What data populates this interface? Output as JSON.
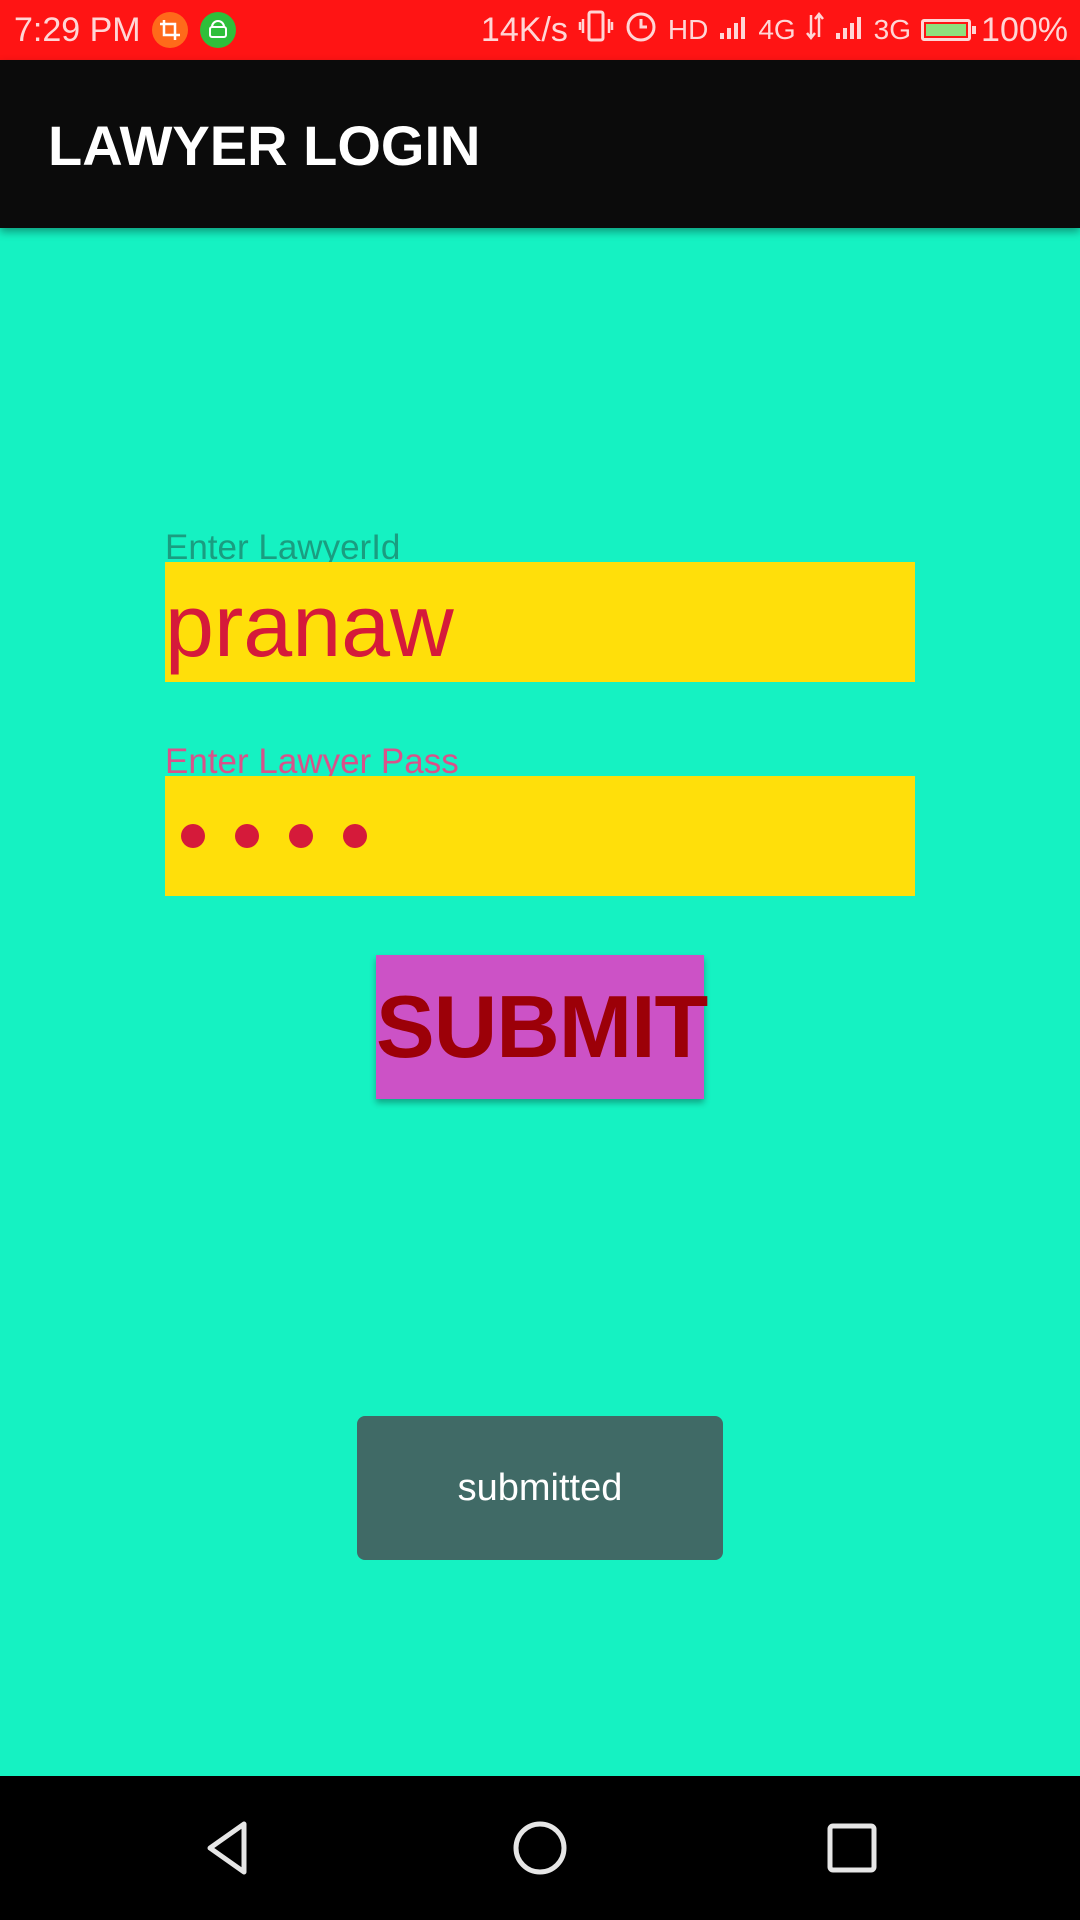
{
  "status_bar": {
    "time": "7:29 PM",
    "speed": "14K/s",
    "hd": "HD",
    "net1": "4G",
    "net2": "3G",
    "battery": "100%",
    "battery_level": 1.0,
    "bg_color": "#ff1414"
  },
  "app_bar": {
    "title": "LAWYER LOGIN"
  },
  "form": {
    "id_label": "Enter LawyerId",
    "id_value": "pranaw",
    "pass_label": "Enter Lawyer Pass",
    "pass_masked_length": 4,
    "submit_label": "SUBMIT"
  },
  "toast": {
    "message": "submitted"
  },
  "colors": {
    "background": "#15f2c2",
    "field_bg": "#ffdf0a",
    "field_text": "#d51a3a",
    "button_bg": "#cc52c6",
    "button_text": "#9c0008",
    "toast_bg": "#406a66"
  },
  "icons": {
    "notif_1": "crop-icon",
    "notif_2": "android-icon",
    "vibrate": "vibrate-icon",
    "alarm": "alarm-icon",
    "nav_back": "back-triangle-icon",
    "nav_home": "home-circle-icon",
    "nav_recent": "recent-square-icon"
  }
}
